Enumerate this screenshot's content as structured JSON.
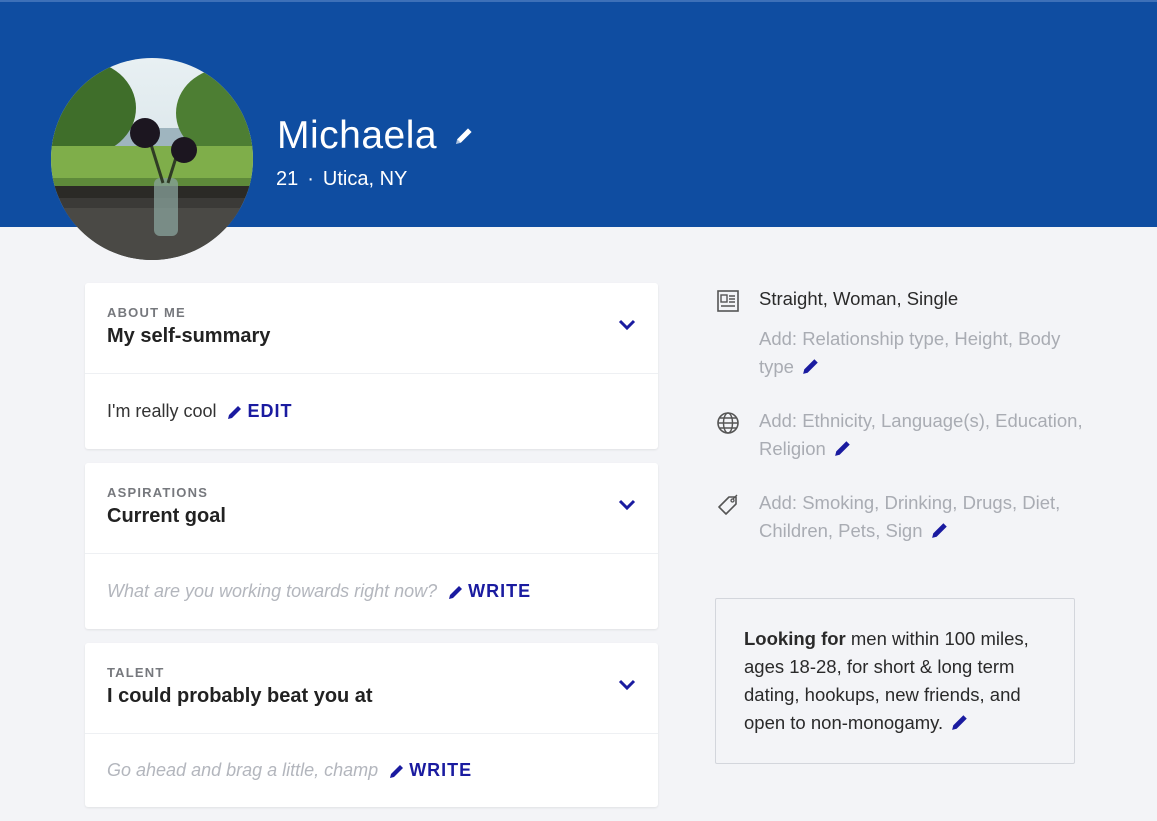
{
  "profile": {
    "name": "Michaela",
    "age": "21",
    "separator": "·",
    "location": "Utica, NY"
  },
  "sections": [
    {
      "category": "ABOUT ME",
      "title": "My self-summary",
      "content": "I'm really cool",
      "action": "EDIT"
    },
    {
      "category": "ASPIRATIONS",
      "title": "Current goal",
      "placeholder": "What are you working towards right now?",
      "action": "WRITE"
    },
    {
      "category": "TALENT",
      "title": "I could probably beat you at",
      "placeholder": "Go ahead and brag a little, champ",
      "action": "WRITE"
    }
  ],
  "details": {
    "basics": {
      "icon": "profile-card-icon",
      "value": "Straight, Woman, Single",
      "add": "Add: Relationship type, Height, Body type"
    },
    "background": {
      "icon": "globe-icon",
      "add": "Add: Ethnicity, Language(s), Education, Religion"
    },
    "lifestyle": {
      "icon": "tag-icon",
      "add": "Add: Smoking, Drinking, Drugs, Diet, Children, Pets, Sign"
    }
  },
  "looking_for": {
    "label": "Looking for",
    "text": " men within 100 miles, ages 18-28, for short & long term dating, hookups, new friends, and open to non-monogamy."
  },
  "colors": {
    "banner": "#0f4da1",
    "accent": "#1a1ba0",
    "background": "#f3f4f7"
  }
}
